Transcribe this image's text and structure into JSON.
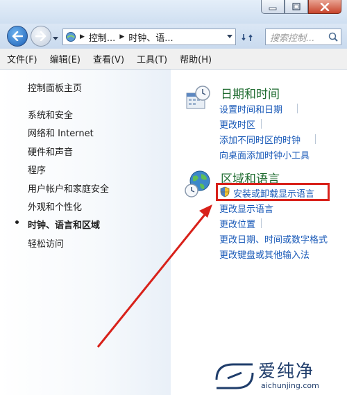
{
  "window": {
    "minimize_icon": "minimize-icon",
    "maximize_icon": "maximize-icon",
    "close_icon": "close-icon"
  },
  "nav": {
    "breadcrumb": [
      "控制...",
      "时钟、语..."
    ],
    "search_placeholder": "搜索控制..."
  },
  "menu": [
    "文件(F)",
    "编辑(E)",
    "查看(V)",
    "工具(T)",
    "帮助(H)"
  ],
  "sidebar": {
    "home": "控制面板主页",
    "categories": [
      {
        "label": "系统和安全",
        "active": false
      },
      {
        "label": "网络和 Internet",
        "active": false
      },
      {
        "label": "硬件和声音",
        "active": false
      },
      {
        "label": "程序",
        "active": false
      },
      {
        "label": "用户帐户和家庭安全",
        "active": false
      },
      {
        "label": "外观和个性化",
        "active": false
      },
      {
        "label": "时钟、语言和区域",
        "active": true
      },
      {
        "label": "轻松访问",
        "active": false
      }
    ]
  },
  "sections": [
    {
      "title": "日期和时间",
      "icon": "calendar-clock-icon",
      "links": [
        "设置时间和日期",
        "更改时区",
        "添加不同时区的时钟",
        "向桌面添加时钟小工具"
      ]
    },
    {
      "title": "区域和语言",
      "icon": "globe-clock-icon",
      "links": [
        "安装或卸载显示语言",
        "更改显示语言",
        "更改位置",
        "更改日期、时间或数字格式",
        "更改键盘或其他输入法"
      ]
    }
  ],
  "watermark": {
    "name": "爱纯净",
    "url": "aichunjing.com"
  },
  "colors": {
    "title_green": "#1e6b2f",
    "link_blue": "#1a5ab8",
    "highlight_red": "#d8211a"
  }
}
